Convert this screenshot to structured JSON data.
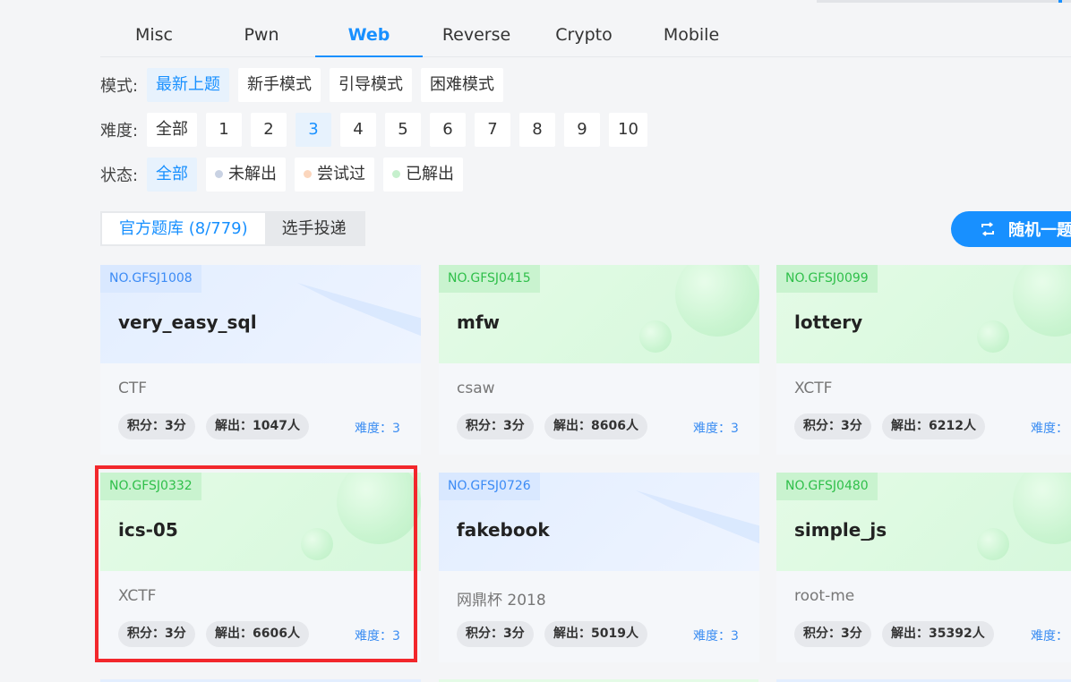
{
  "tabs": [
    {
      "label": "Misc",
      "active": false
    },
    {
      "label": "Pwn",
      "active": false
    },
    {
      "label": "Web",
      "active": true
    },
    {
      "label": "Reverse",
      "active": false
    },
    {
      "label": "Crypto",
      "active": false
    },
    {
      "label": "Mobile",
      "active": false
    }
  ],
  "filters": {
    "mode": {
      "label": "模式:",
      "options": [
        "最新上题",
        "新手模式",
        "引导模式",
        "困难模式"
      ],
      "active": "最新上题"
    },
    "difficulty": {
      "label": "难度:",
      "options": [
        "全部",
        "1",
        "2",
        "3",
        "4",
        "5",
        "6",
        "7",
        "8",
        "9",
        "10"
      ],
      "active": "3"
    },
    "status": {
      "label": "状态:",
      "options": [
        {
          "text": "全部",
          "dot": null
        },
        {
          "text": "未解出",
          "dot": "#c9d2e3"
        },
        {
          "text": "尝试过",
          "dot": "#fbd6bd"
        },
        {
          "text": "已解出",
          "dot": "#c6f0cd"
        }
      ],
      "active": "全部"
    }
  },
  "library": {
    "official": "官方题库 (8/779)",
    "player": "选手投递"
  },
  "random_button": "随机一题",
  "cards": [
    {
      "id": "NO.GFSJ1008",
      "title": "very_easy_sql",
      "source": "CTF",
      "score": "积分：3分",
      "solved": "解出：1047人",
      "difficulty": "难度：3",
      "theme": "blue"
    },
    {
      "id": "NO.GFSJ0415",
      "title": "mfw",
      "source": "csaw",
      "score": "积分：3分",
      "solved": "解出：8606人",
      "difficulty": "难度：3",
      "theme": "green"
    },
    {
      "id": "NO.GFSJ0099",
      "title": "lottery",
      "source": "XCTF",
      "score": "积分：3分",
      "solved": "解出：6212人",
      "difficulty": "难度：",
      "theme": "green"
    },
    {
      "id": "NO.GFSJ0332",
      "title": "ics-05",
      "source": "XCTF",
      "score": "积分：3分",
      "solved": "解出：6606人",
      "difficulty": "难度：3",
      "theme": "green"
    },
    {
      "id": "NO.GFSJ0726",
      "title": "fakebook",
      "source": "网鼎杯 2018",
      "score": "积分：3分",
      "solved": "解出：5019人",
      "difficulty": "难度：3",
      "theme": "blue"
    },
    {
      "id": "NO.GFSJ0480",
      "title": "simple_js",
      "source": "root-me",
      "score": "积分：3分",
      "solved": "解出：35392人",
      "difficulty": "难度：",
      "theme": "green"
    }
  ],
  "colors": {
    "accent": "#1890ff",
    "highlight_border": "#f2272c"
  }
}
